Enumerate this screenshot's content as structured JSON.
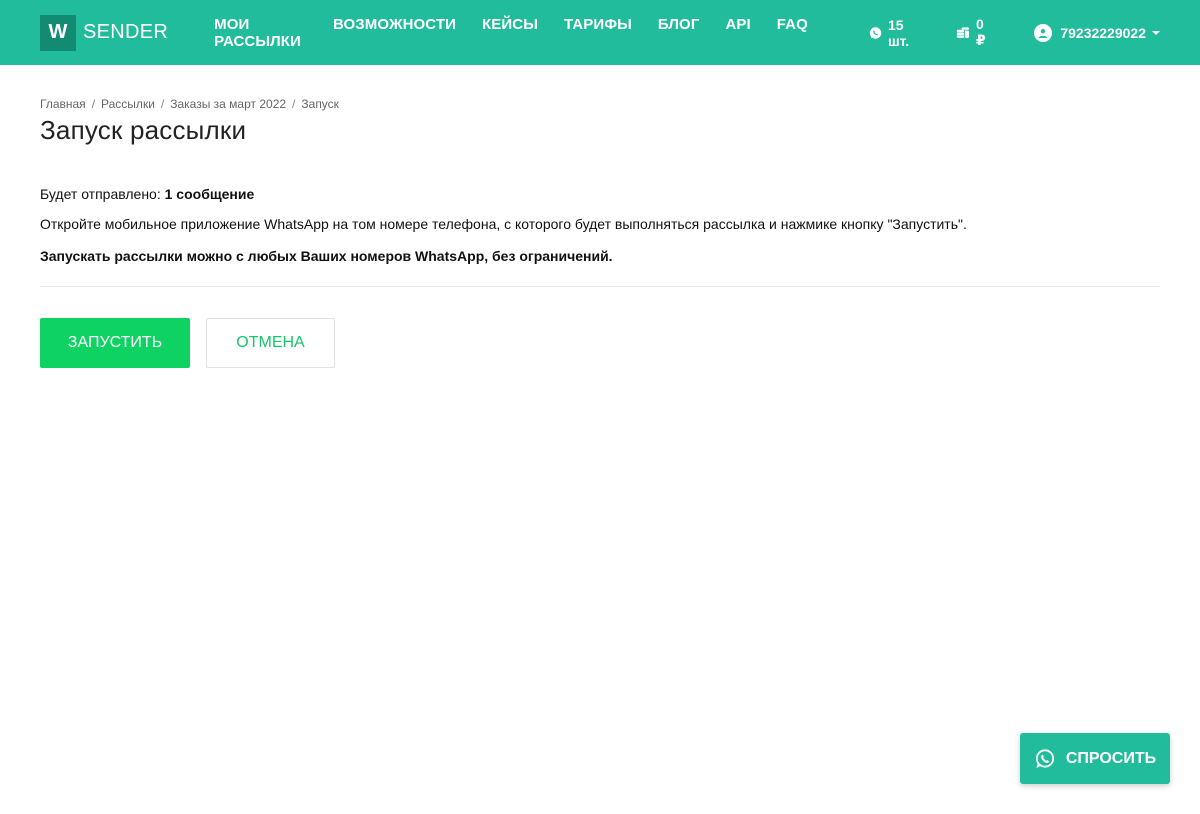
{
  "brand": {
    "logo_letter": "W",
    "name": "SENDER",
    "color": "#21bc9b"
  },
  "nav": {
    "items": [
      {
        "label": "МОИ РАССЫЛКИ"
      },
      {
        "label": "ВОЗМОЖНОСТИ"
      },
      {
        "label": "КЕЙСЫ"
      },
      {
        "label": "ТАРИФЫ"
      },
      {
        "label": "БЛОГ"
      },
      {
        "label": "API"
      },
      {
        "label": "FAQ"
      }
    ]
  },
  "header_right": {
    "whatsapp_count": "15 шт.",
    "whatsapp_icon": "whatsapp-icon",
    "balance": "0 ₽",
    "balance_icon": "coins-icon",
    "user_phone": "79232229022",
    "user_icon": "user-avatar-icon"
  },
  "breadcrumb": [
    "Главная",
    "Рассылки",
    "Заказы за март 2022",
    "Запуск"
  ],
  "page": {
    "title": "Запуск рассылки",
    "will_send_label": "Будет отправлено: ",
    "will_send_value": "1 сообщение",
    "instruction": "Откройте мобильное приложение WhatsApp на том номере телефона, с которого будет выполняться рассылка и нажмике кнопку \"Запустить\".",
    "note": "Запускать рассылки можно с любых Ваших номеров WhatsApp, без ограничений."
  },
  "actions": {
    "start_label": "ЗАПУСТИТЬ",
    "cancel_label": "ОТМЕНА",
    "start_color": "#0ed262"
  },
  "ask_button": {
    "label": "СПРОСИТЬ",
    "icon": "whatsapp-icon"
  }
}
